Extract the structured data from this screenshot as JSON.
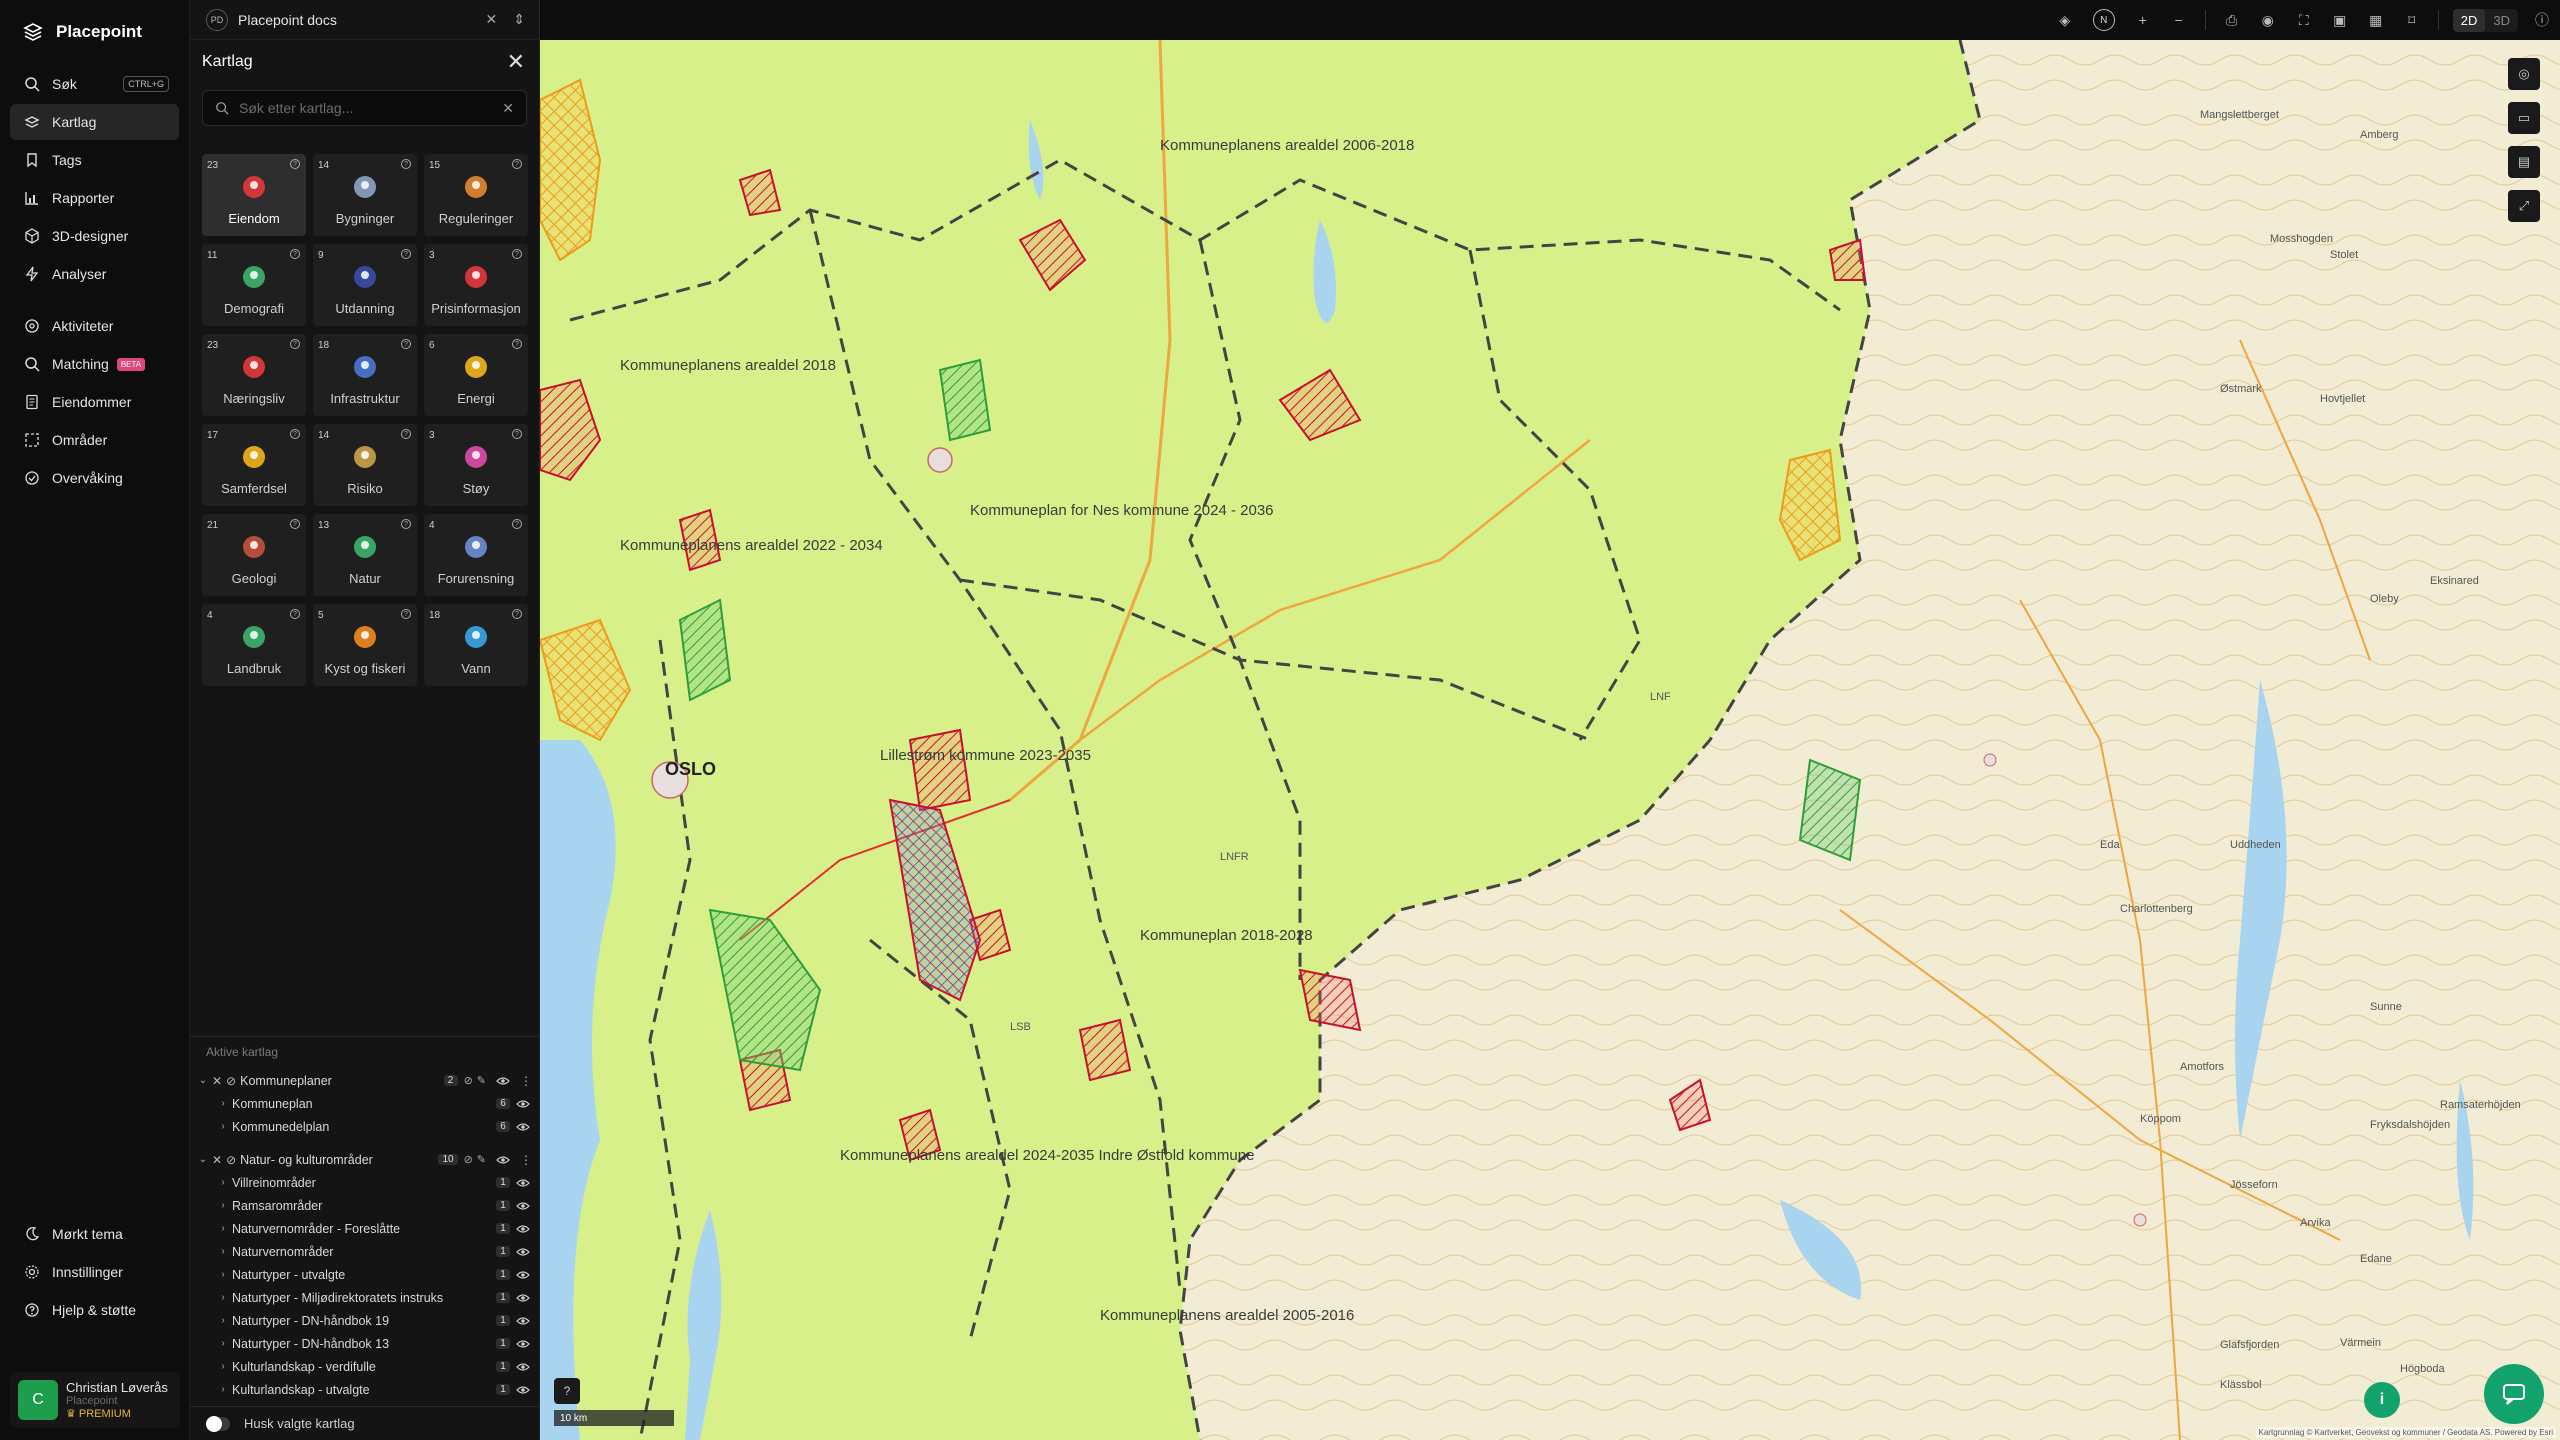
{
  "app": {
    "brand": "Placepoint"
  },
  "nav": {
    "items": [
      {
        "label": "Søk",
        "shortcut": "CTRL+G"
      },
      {
        "label": "Kartlag"
      },
      {
        "label": "Tags"
      },
      {
        "label": "Rapporter"
      },
      {
        "label": "3D-designer"
      },
      {
        "label": "Analyser"
      }
    ],
    "items2": [
      {
        "label": "Aktiviteter"
      },
      {
        "label": "Matching",
        "badge": "BETA"
      },
      {
        "label": "Eiendommer"
      },
      {
        "label": "Områder"
      },
      {
        "label": "Overvåking"
      }
    ],
    "bottom": [
      {
        "label": "Mørkt tema"
      },
      {
        "label": "Innstillinger"
      },
      {
        "label": "Hjelp & støtte"
      }
    ],
    "user": {
      "initial": "C",
      "name": "Christian Løverås",
      "org": "Placepoint",
      "plan": "PREMIUM"
    }
  },
  "doc": {
    "badge": "PD",
    "title": "Placepoint docs"
  },
  "panel": {
    "title": "Kartlag",
    "search_placeholder": "Søk etter kartlag...",
    "tiles": [
      {
        "count": "23",
        "label": "Eiendom",
        "icon": "map-pin-icon",
        "color": "#e5393b"
      },
      {
        "count": "14",
        "label": "Bygninger",
        "icon": "building-icon",
        "color": "#8fa3c6"
      },
      {
        "count": "15",
        "label": "Reguleringer",
        "icon": "signpost-icon",
        "color": "#e48a2f"
      },
      {
        "count": "11",
        "label": "Demografi",
        "icon": "people-icon",
        "color": "#3db36b"
      },
      {
        "count": "9",
        "label": "Utdanning",
        "icon": "graduation-cap-icon",
        "color": "#3a4ea8"
      },
      {
        "count": "3",
        "label": "Prisinformasjon",
        "icon": "shopping-bag-icon",
        "color": "#e5393b"
      },
      {
        "count": "23",
        "label": "Næringsliv",
        "icon": "briefcase-icon",
        "color": "#e5393b"
      },
      {
        "count": "18",
        "label": "Infrastruktur",
        "icon": "globe-icon",
        "color": "#4a78d4"
      },
      {
        "count": "6",
        "label": "Energi",
        "icon": "lightning-icon",
        "color": "#f2b418"
      },
      {
        "count": "17",
        "label": "Samferdsel",
        "icon": "bus-icon",
        "color": "#f2b418"
      },
      {
        "count": "14",
        "label": "Risiko",
        "icon": "risk-icon",
        "color": "#c9a44a"
      },
      {
        "count": "3",
        "label": "Støy",
        "icon": "noise-icon",
        "color": "#e04caa"
      },
      {
        "count": "21",
        "label": "Geologi",
        "icon": "geology-icon",
        "color": "#c4533a"
      },
      {
        "count": "13",
        "label": "Natur",
        "icon": "leaf-icon",
        "color": "#3db36b"
      },
      {
        "count": "4",
        "label": "Forurensning",
        "icon": "factory-icon",
        "color": "#6c8fd6"
      },
      {
        "count": "4",
        "label": "Landbruk",
        "icon": "sprout-icon",
        "color": "#3db36b"
      },
      {
        "count": "5",
        "label": "Kyst og fiskeri",
        "icon": "fish-icon",
        "color": "#f28a1e"
      },
      {
        "count": "18",
        "label": "Vann",
        "icon": "water-drop-icon",
        "color": "#3aa6e8"
      }
    ],
    "active_title": "Aktive kartlag",
    "groups": [
      {
        "name": "Kommuneplaner",
        "count": "2",
        "children": [
          {
            "name": "Kommuneplan",
            "count": "6"
          },
          {
            "name": "Kommunedelplan",
            "count": "6"
          }
        ]
      },
      {
        "name": "Natur- og kulturområder",
        "count": "10",
        "children": [
          {
            "name": "Villreinområder",
            "count": "1"
          },
          {
            "name": "Ramsarområder",
            "count": "1"
          },
          {
            "name": "Naturvernområder - Foreslåtte",
            "count": "1"
          },
          {
            "name": "Naturvernområder",
            "count": "1"
          },
          {
            "name": "Naturtyper - utvalgte",
            "count": "1"
          },
          {
            "name": "Naturtyper - Miljødirektoratets instruks",
            "count": "1"
          },
          {
            "name": "Naturtyper - DN-håndbok 19",
            "count": "1"
          },
          {
            "name": "Naturtyper - DN-håndbok 13",
            "count": "1"
          },
          {
            "name": "Kulturlandskap - verdifulle",
            "count": "1"
          },
          {
            "name": "Kulturlandskap - utvalgte",
            "count": "1"
          }
        ]
      }
    ],
    "remember_label": "Husk valgte kartlag"
  },
  "topbar": {
    "compass": "N",
    "mode_2d": "2D",
    "mode_3d": "3D"
  },
  "map": {
    "scale": "10 km",
    "attribution": "Kartgrunnlag © Kartverket, Geovekst og kommuner / Geodata AS. Powered by Esri",
    "labels": [
      "Kommuneplanens arealdel 2006-2018",
      "Kommuneplanens arealdel 2018",
      "Kommuneplan 2018-2028",
      "Kommuneplan for Nes kommune 2024 - 2036",
      "Lillestrøm kommune 2023-2035",
      "Kommuneplanens arealdel 2022 - 2034",
      "Kommuneplanens arealdel 2005-2016",
      "Kommuneplanens arealdel 2024-2035 Indre Østfold kommune",
      "OSLO",
      "LNF",
      "LNFR",
      "LSB",
      "Mangslettberget",
      "Amberg",
      "Mosshogden",
      "Stolet",
      "Østmark",
      "Hovtjellet",
      "Oleby",
      "Eksinared",
      "Sunne",
      "Fryksdalshöjden",
      "Ramsaterhöjden",
      "Charlottenberg",
      "Eda",
      "Amotfors",
      "Köppom",
      "Jösseforn",
      "Arvika",
      "Glafsfjorden",
      "Klässbol",
      "Högboda",
      "Uddheden",
      "Värmein",
      "Edane"
    ]
  }
}
